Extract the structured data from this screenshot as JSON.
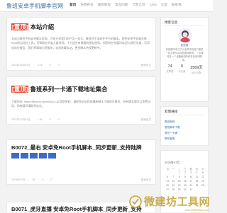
{
  "site": {
    "brand": "鲁班安卓手机脚本官网"
  },
  "nav": [
    "首页",
    "免费养号",
    "最新教程",
    "常见问题",
    "代售几何",
    "CDN",
    "文章",
    "联系我"
  ],
  "posts": [
    {
      "tag": "[置顶]",
      "title": "本站介绍",
      "body": "本站为鲁班手机安卓脚本官网，为你分享我们的产品一站式，集多项主流软件平台的脚本，提供安卓手机端无需Root的自动化工具，可帮助你节省大量时间。十分适合有需要的朋友使用，如您有任何疑问欢迎与我们沟通，可添加站长微信，我们将竭诚为您服务，欢迎收藏本站，更多脚本持续更新中。",
      "date": "2021年12月01日",
      "views": "3.2k",
      "comments": "0",
      "likes": "0",
      "more": "阅读全文"
    },
    {
      "tag": "[置顶]",
      "title": "鲁班系列一卡通下载地址集合",
      "body": "下载地址: https://lanzoui.com/b0j2LzJd 提取密码：请联系站长获取最新脚本下载地址集合，所有脚本都可以免费试用，如有疑问请联系站长。",
      "date": "2021年12月01日",
      "views": "1.8k",
      "comments": "0",
      "likes": "0",
      "more": "阅读全文"
    },
    {
      "title": "B0072_最右 安卓免Root手机脚本_同步更新_支持陆牌",
      "date": "2025年07月",
      "views": "26",
      "comments": "0",
      "likes": "0",
      "more": "阅读全文"
    },
    {
      "title": "B0071_虎牙直播 安卓免Root手机脚本_同步更新_支持",
      "date": "",
      "views": "",
      "comments": "",
      "likes": "",
      "more": ""
    }
  ],
  "sidebar": {
    "profile_title": "博客信息",
    "name": "鲁班网",
    "desc": "鲁班脚本专注于为安卓手机用户提供一站式免Root手机脚本服务，一卡通可在一个设备使用所有鲁班系列脚本。",
    "stats": [
      {
        "n": "74",
        "l": "文章数"
      },
      {
        "n": "0",
        "l": "评论数"
      },
      {
        "n": "2569天",
        "l": "运行天数"
      }
    ],
    "links_title": "友情链接",
    "links": [
      "鲁班官网",
      "鲁班脚本下载",
      "鲁班一卡通",
      "联系客服"
    ],
    "cal_month": "2025年07月",
    "cal_head": [
      "日",
      "一",
      "二",
      "三",
      "四",
      "五",
      "六"
    ],
    "cal_rows": [
      [
        "",
        "",
        "1",
        "2",
        "3",
        "4",
        "5"
      ],
      [
        "6",
        "7",
        "8",
        "9",
        "10",
        "11",
        "12"
      ],
      [
        "13",
        "14",
        "15",
        "16",
        "17",
        "18",
        "19"
      ],
      [
        "20",
        "21",
        "22",
        "23",
        "24",
        "25",
        "26"
      ],
      [
        "27",
        "28",
        "29",
        "30",
        "31",
        "",
        ""
      ]
    ]
  },
  "watermark": {
    "text": "微建坊工具网",
    "url": "www.weijianfang.com"
  }
}
